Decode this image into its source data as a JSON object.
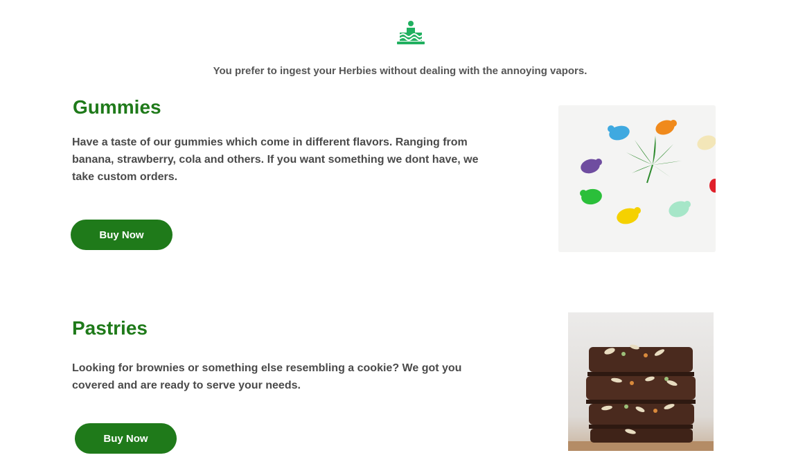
{
  "intro": {
    "icon": "cake-icon",
    "tagline": "You prefer to ingest your Herbies without dealing with the annoying vapors."
  },
  "sections": [
    {
      "title": "Gummies",
      "description": "Have a taste of our gummies which come in different flavors. Ranging from banana, strawberry, cola and others. If you want something we dont have, we take custom orders.",
      "button_label": "Buy Now",
      "image": "gummy-bears-with-cannabis-leaf"
    },
    {
      "title": "Pastries",
      "description": "Looking for brownies or something else resembling a cookie? We got you covered and are ready to serve your needs.",
      "button_label": "Buy Now",
      "image": "stacked-brownies"
    }
  ],
  "colors": {
    "brand_green": "#1f7a1a",
    "icon_green": "#21b060",
    "text_gray": "#4a4a4a"
  }
}
